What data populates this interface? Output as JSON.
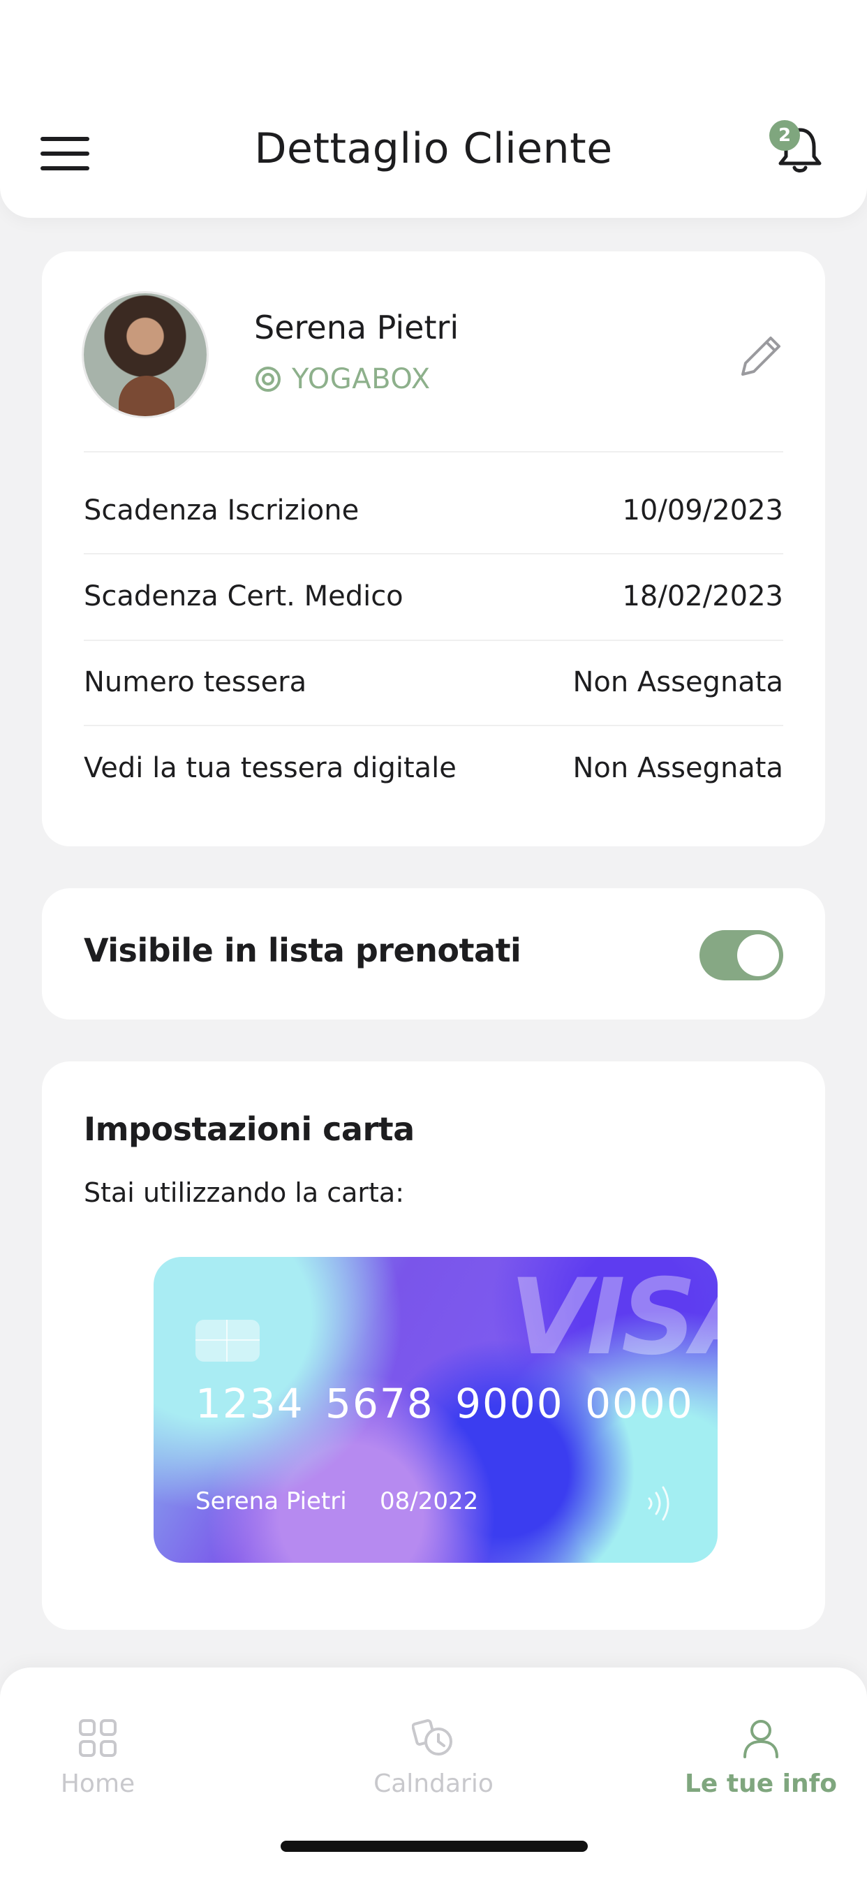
{
  "header": {
    "title": "Dettaglio Cliente",
    "notification_count": "2"
  },
  "profile": {
    "name": "Serena Pietri",
    "studio": "YOGABOX",
    "rows": [
      {
        "label": "Scadenza Iscrizione",
        "value": "10/09/2023"
      },
      {
        "label": "Scadenza Cert. Medico",
        "value": "18/02/2023"
      },
      {
        "label": "Numero tessera",
        "value": "Non Assegnata"
      },
      {
        "label": "Vedi la tua tessera digitale",
        "value": "Non Assegnata"
      }
    ]
  },
  "visibility": {
    "label": "Visibile in lista prenotati",
    "enabled": true
  },
  "payment": {
    "title": "Impostazioni carta",
    "subtitle": "Stai utilizzando la carta:",
    "card": {
      "brand": "VISA",
      "number": "1234 5678 9000 0000",
      "holder": "Serena Pietri",
      "expiry": "08/2022"
    }
  },
  "bottom_nav": {
    "items": [
      {
        "label": "Home",
        "icon": "grid-icon"
      },
      {
        "label": "Calndario",
        "icon": "history-calendar-icon"
      },
      {
        "label": "Le tue info",
        "icon": "user-icon"
      }
    ],
    "active_index": 2
  },
  "colors": {
    "accent": "#7fa67e",
    "background": "#f2f2f3"
  }
}
